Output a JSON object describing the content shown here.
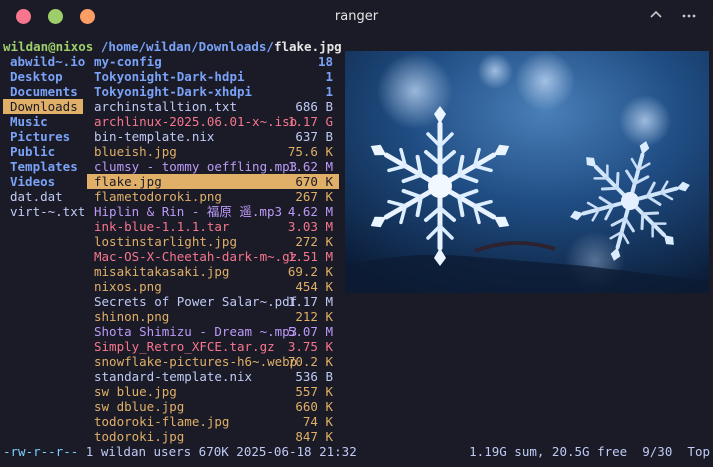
{
  "window": {
    "title": "ranger",
    "controls": {
      "close_color": "#f7768e",
      "minimize_color": "#9ece6a",
      "maximize_color": "#ff9e64"
    }
  },
  "header": {
    "user_host": "wildan@nixos",
    "path_prefix": "/home/wildan/Downloads/",
    "current_file": "flake.jpg"
  },
  "parent_column": {
    "items": [
      {
        "name": "abwild~.io",
        "color": "#7aa2f7",
        "bold": true
      },
      {
        "name": "Desktop",
        "color": "#7aa2f7",
        "bold": true
      },
      {
        "name": "Documents",
        "color": "#7aa2f7",
        "bold": true
      },
      {
        "name": "Downloads",
        "color": "#1a1b26",
        "bold": false,
        "selected": true
      },
      {
        "name": "Music",
        "color": "#7aa2f7",
        "bold": true
      },
      {
        "name": "Pictures",
        "color": "#7aa2f7",
        "bold": true
      },
      {
        "name": "Public",
        "color": "#7aa2f7",
        "bold": true
      },
      {
        "name": "Templates",
        "color": "#7aa2f7",
        "bold": true
      },
      {
        "name": "Videos",
        "color": "#7aa2f7",
        "bold": true
      },
      {
        "name": "dat.dat",
        "color": "#c0caf5",
        "bold": false
      },
      {
        "name": "virt-~.txt",
        "color": "#c0caf5",
        "bold": false
      }
    ]
  },
  "files": [
    {
      "name": "my-config",
      "size": "18",
      "color": "#7aa2f7",
      "bold": true
    },
    {
      "name": "Tokyonight-Dark-hdpi",
      "size": "1",
      "color": "#7aa2f7",
      "bold": true
    },
    {
      "name": "Tokyonight-Dark-xhdpi",
      "size": "1",
      "color": "#7aa2f7",
      "bold": true
    },
    {
      "name": "archinstalltion.txt",
      "size": "686 B",
      "color": "#c0caf5"
    },
    {
      "name": "archlinux-2025.06.01-x~.iso",
      "size": "1.17 G",
      "color": "#f7768e"
    },
    {
      "name": "bin-template.nix",
      "size": "637 B",
      "color": "#c0caf5"
    },
    {
      "name": "blueish.jpg",
      "size": "75.6 K",
      "color": "#e0af68"
    },
    {
      "name": "clumsy - tommy oeffling.mp3",
      "size": "1.62 M",
      "color": "#bb9af7"
    },
    {
      "name": "flake.jpg",
      "size": "670 K",
      "color": "#1a1b26",
      "selected": true
    },
    {
      "name": "flametodoroki.png",
      "size": "267 K",
      "color": "#e0af68"
    },
    {
      "name": "Hiplin & Rin - 福原 遥.mp3",
      "size": "4.62 M",
      "color": "#bb9af7"
    },
    {
      "name": "ink-blue-1.1.1.tar",
      "size": "3.03 M",
      "color": "#f7768e"
    },
    {
      "name": "lostinstarlight.jpg",
      "size": "272 K",
      "color": "#e0af68"
    },
    {
      "name": "Mac-OS-X-Cheetah-dark-m~.gz",
      "size": "1.51 M",
      "color": "#f7768e"
    },
    {
      "name": "misakitakasaki.jpg",
      "size": "69.2 K",
      "color": "#e0af68"
    },
    {
      "name": "nixos.png",
      "size": "454 K",
      "color": "#e0af68"
    },
    {
      "name": "Secrets of Power Salar~.pdf",
      "size": "1.17 M",
      "color": "#c0caf5"
    },
    {
      "name": "shinon.png",
      "size": "212 K",
      "color": "#e0af68"
    },
    {
      "name": "Shota Shimizu - Dream ~.mp3",
      "size": "5.07 M",
      "color": "#bb9af7"
    },
    {
      "name": "Simply_Retro_XFCE.tar.gz",
      "size": "3.75 K",
      "color": "#f7768e"
    },
    {
      "name": "snowflake-pictures-h6~.webp",
      "size": "70.2 K",
      "color": "#e0af68"
    },
    {
      "name": "standard-template.nix",
      "size": "536 B",
      "color": "#c0caf5"
    },
    {
      "name": "sw blue.jpg",
      "size": "557 K",
      "color": "#e0af68"
    },
    {
      "name": "sw dblue.jpg",
      "size": "660 K",
      "color": "#e0af68"
    },
    {
      "name": "todoroki-flame.jpg",
      "size": "74 K",
      "color": "#e0af68"
    },
    {
      "name": "todoroki.jpg",
      "size": "847 K",
      "color": "#e0af68"
    }
  ],
  "colors": {
    "background": "#1a1b26",
    "user_host": "#9ece6a",
    "path": "#7aa2f7",
    "selection": "#e0af68",
    "status_perms": "#7dcfff"
  },
  "status": {
    "permissions": "-rw-r--r--",
    "info": " 1 wildan users 670K 2025-06-18 21:32",
    "disk": "1.19G sum, 20.5G free",
    "position": "9/30",
    "scroll": "Top"
  },
  "icons": {
    "collapse": "chevron-up-icon",
    "menu": "more-horizontal-icon"
  }
}
